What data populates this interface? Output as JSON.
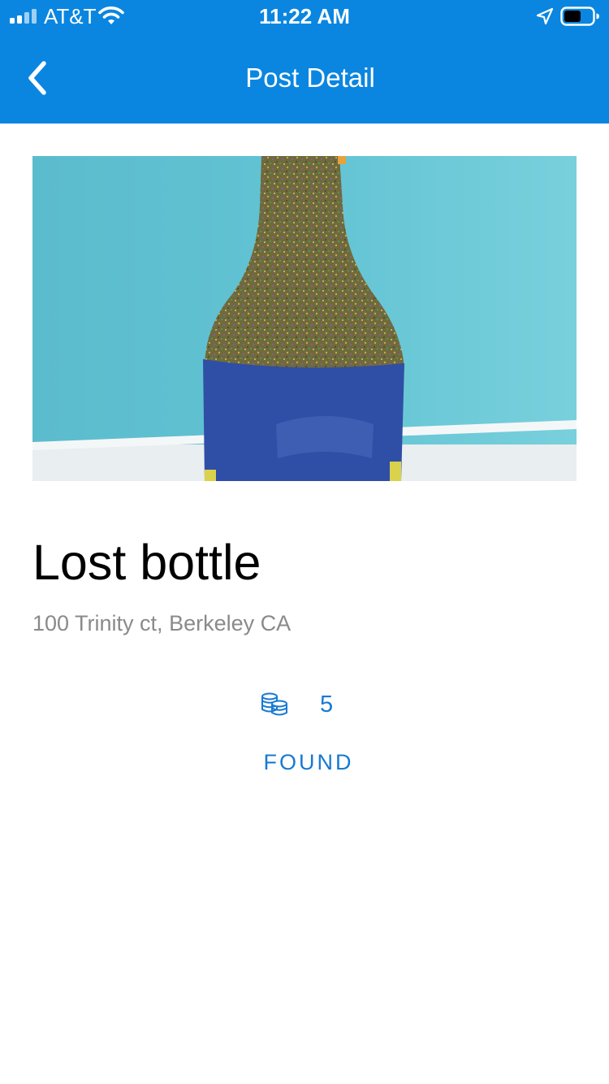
{
  "status_bar": {
    "carrier": "AT&T",
    "time": "11:22 AM",
    "icons": [
      "signal-icon",
      "wifi-icon",
      "location-arrow-icon",
      "battery-icon"
    ]
  },
  "nav": {
    "title": "Post Detail",
    "back_icon": "chevron-left-icon"
  },
  "post": {
    "image_alt": "Glitter bottle wrapped in blue tape",
    "title": "Lost bottle",
    "address": "100 Trinity ct, Berkeley CA",
    "reward_icon": "coins-icon",
    "reward": "5",
    "action_label": "FOUND"
  },
  "colors": {
    "header": "#0a86e0",
    "accent": "#1779d2",
    "secondary_text": "#8a8a8a"
  }
}
